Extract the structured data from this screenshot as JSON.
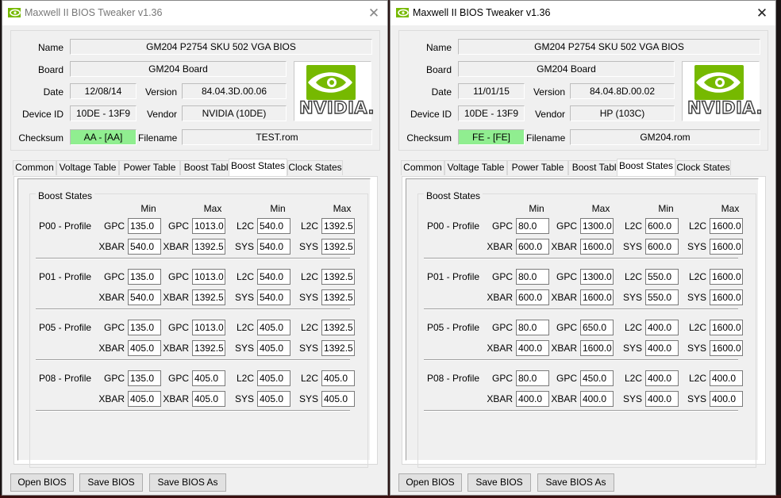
{
  "windows": [
    {
      "title": "Maxwell II BIOS Tweaker v1.36",
      "info": {
        "name_label": "Name",
        "name": "GM204 P2754 SKU 502 VGA BIOS",
        "board_label": "Board",
        "board": "GM204 Board",
        "date_label": "Date",
        "date": "12/08/14",
        "version_label": "Version",
        "version": "84.04.3D.00.06",
        "device_label": "Device ID",
        "device_id": "10DE - 13F9",
        "vendor_label": "Vendor",
        "vendor": "NVIDIA (10DE)",
        "checksum_label": "Checksum",
        "checksum": "AA - [AA]",
        "filename_label": "Filename",
        "filename": "TEST.rom",
        "logo_text": "NVIDIA."
      },
      "tabs": [
        "Common",
        "Voltage Table",
        "Power Table",
        "Boost Table",
        "Boost States",
        "Clock States"
      ],
      "active_tab": "Boost States",
      "group_title": "Boost States",
      "col_headers": [
        "Min",
        "Max",
        "Min",
        "Max"
      ],
      "profiles": [
        {
          "name": "P00 - Profile",
          "labels": [
            "GPC",
            "GPC",
            "L2C",
            "L2C",
            "XBAR",
            "XBAR",
            "SYS",
            "SYS"
          ],
          "values": [
            "135.0",
            "1013.0",
            "540.0",
            "1392.5",
            "540.0",
            "1392.5",
            "540.0",
            "1392.5"
          ]
        },
        {
          "name": "P01 - Profile",
          "labels": [
            "GPC",
            "GPC",
            "L2C",
            "L2C",
            "XBAR",
            "XBAR",
            "SYS",
            "SYS"
          ],
          "values": [
            "135.0",
            "1013.0",
            "540.0",
            "1392.5",
            "540.0",
            "1392.5",
            "540.0",
            "1392.5"
          ]
        },
        {
          "name": "P05 - Profile",
          "labels": [
            "GPC",
            "GPC",
            "L2C",
            "L2C",
            "XBAR",
            "XBAR",
            "SYS",
            "SYS"
          ],
          "values": [
            "135.0",
            "1013.0",
            "405.0",
            "1392.5",
            "405.0",
            "1392.5",
            "405.0",
            "1392.5"
          ]
        },
        {
          "name": "P08 - Profile",
          "labels": [
            "GPC",
            "GPC",
            "L2C",
            "L2C",
            "XBAR",
            "XBAR",
            "SYS",
            "SYS"
          ],
          "values": [
            "135.0",
            "405.0",
            "405.0",
            "405.0",
            "405.0",
            "405.0",
            "405.0",
            "405.0"
          ]
        }
      ],
      "buttons": [
        "Open BIOS",
        "Save BIOS",
        "Save BIOS As"
      ]
    },
    {
      "title": "Maxwell II BIOS Tweaker v1.36",
      "info": {
        "name_label": "Name",
        "name": "GM204 P2754 SKU 502 VGA BIOS",
        "board_label": "Board",
        "board": "GM204 Board",
        "date_label": "Date",
        "date": "11/01/15",
        "version_label": "Version",
        "version": "84.04.8D.00.02",
        "device_label": "Device ID",
        "device_id": "10DE - 13F9",
        "vendor_label": "Vendor",
        "vendor": "HP (103C)",
        "checksum_label": "Checksum",
        "checksum": "FE - [FE]",
        "filename_label": "Filename",
        "filename": "GM204.rom",
        "logo_text": "NVIDIA."
      },
      "tabs": [
        "Common",
        "Voltage Table",
        "Power Table",
        "Boost Table",
        "Boost States",
        "Clock States"
      ],
      "active_tab": "Boost States",
      "group_title": "Boost States",
      "col_headers": [
        "Min",
        "Max",
        "Min",
        "Max"
      ],
      "profiles": [
        {
          "name": "P00 - Profile",
          "labels": [
            "GPC",
            "GPC",
            "L2C",
            "L2C",
            "XBAR",
            "XBAR",
            "SYS",
            "SYS"
          ],
          "values": [
            "80.0",
            "1300.0",
            "600.0",
            "1600.0",
            "600.0",
            "1600.0",
            "600.0",
            "1600.0"
          ]
        },
        {
          "name": "P01 - Profile",
          "labels": [
            "GPC",
            "GPC",
            "L2C",
            "L2C",
            "XBAR",
            "XBAR",
            "SYS",
            "SYS"
          ],
          "values": [
            "80.0",
            "1300.0",
            "550.0",
            "1600.0",
            "600.0",
            "1600.0",
            "550.0",
            "1600.0"
          ]
        },
        {
          "name": "P05 - Profile",
          "labels": [
            "GPC",
            "GPC",
            "L2C",
            "L2C",
            "XBAR",
            "XBAR",
            "SYS",
            "SYS"
          ],
          "values": [
            "80.0",
            "650.0",
            "400.0",
            "1600.0",
            "400.0",
            "1600.0",
            "400.0",
            "1600.0"
          ]
        },
        {
          "name": "P08 - Profile",
          "labels": [
            "GPC",
            "GPC",
            "L2C",
            "L2C",
            "XBAR",
            "XBAR",
            "SYS",
            "SYS"
          ],
          "values": [
            "80.0",
            "450.0",
            "400.0",
            "400.0",
            "400.0",
            "400.0",
            "400.0",
            "400.0"
          ]
        }
      ],
      "buttons": [
        "Open BIOS",
        "Save BIOS",
        "Save BIOS As"
      ]
    }
  ],
  "colors": {
    "checksum_ok": "#90ee90",
    "logo_green": "#76b900"
  }
}
